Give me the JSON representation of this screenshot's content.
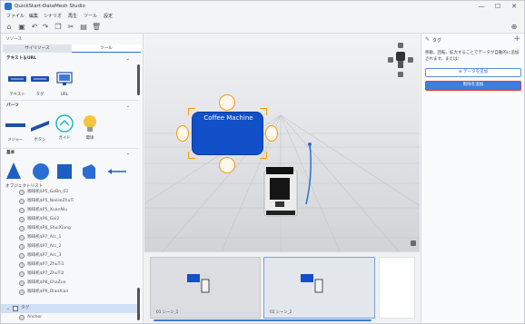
{
  "window": {
    "title": "QuickStart-DataMesh Studio",
    "controls": [
      "—",
      "☐",
      "✕"
    ]
  },
  "menu": [
    "ファイル",
    "編集",
    "シナリオ",
    "再生",
    "ツール",
    "設定"
  ],
  "left_panel": {
    "header": "リソース",
    "tabs": [
      "サイリソース",
      "ツール"
    ],
    "groups": {
      "text": {
        "label": "テキスト＆URL",
        "items": [
          "テキスト",
          "タグ",
          "URL"
        ]
      },
      "parts": {
        "label": "パーツ",
        "items": [
          "メジャー",
          "ボタン",
          "ガイド",
          "電球"
        ]
      },
      "basic": {
        "label": "基本"
      }
    },
    "object_list": {
      "title": "オブジェクトリスト",
      "rows": [
        "咖啡机$P5_GoBn_02",
        "咖啡机$P5_NeiHeZhuTi",
        "咖啡机$P5_XuanNiu",
        "咖啡机$P6_Gai2",
        "咖啡机$P6_ShuiXiang",
        "咖啡机$P7_Arc_1",
        "咖啡机$P7_Arc_2",
        "咖啡机$P7_Arc_3",
        "咖啡机$P7_ZhuTi1",
        "咖啡机$P7_ZhuTi2",
        "咖啡机$P8_ChaZuo",
        "咖啡机$P9_DianXian",
        "タグ",
        "Anchor"
      ]
    }
  },
  "viewport": {
    "tag_text": "Coffee Machine"
  },
  "filmstrip": {
    "scenes": [
      {
        "label": "01 シーン_1"
      },
      {
        "label": "02 シーン_2"
      }
    ]
  },
  "right_panel": {
    "title": "タグ",
    "description": "移動、回転、拡大することでデータが自動的に追加されます。または：",
    "add_data_button": "データを追加",
    "delete_all_button": "削除を追加"
  },
  "colors": {
    "accent": "#2b6fd6",
    "tag_fill": "#1150c9",
    "handle_orange": "#f39c12",
    "highlight_red": "#e53935"
  }
}
